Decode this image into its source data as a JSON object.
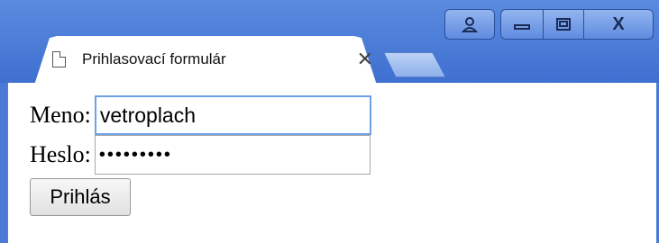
{
  "window": {
    "controls": {
      "profile_icon": "person-icon",
      "minimize_icon": "minimize-icon",
      "maximize_icon": "maximize-icon",
      "close_label": "X"
    }
  },
  "tab": {
    "title": "Prihlasovací formulár",
    "close_label": "✕",
    "icon": "page-icon"
  },
  "form": {
    "username": {
      "label": "Meno:",
      "value": "vetroplach"
    },
    "password": {
      "label": "Heslo:",
      "value": "•••••••••"
    },
    "submit_label": "Prihlás"
  },
  "colors": {
    "frame": "#4a7ad6",
    "focus_border": "#6ea0e6"
  }
}
